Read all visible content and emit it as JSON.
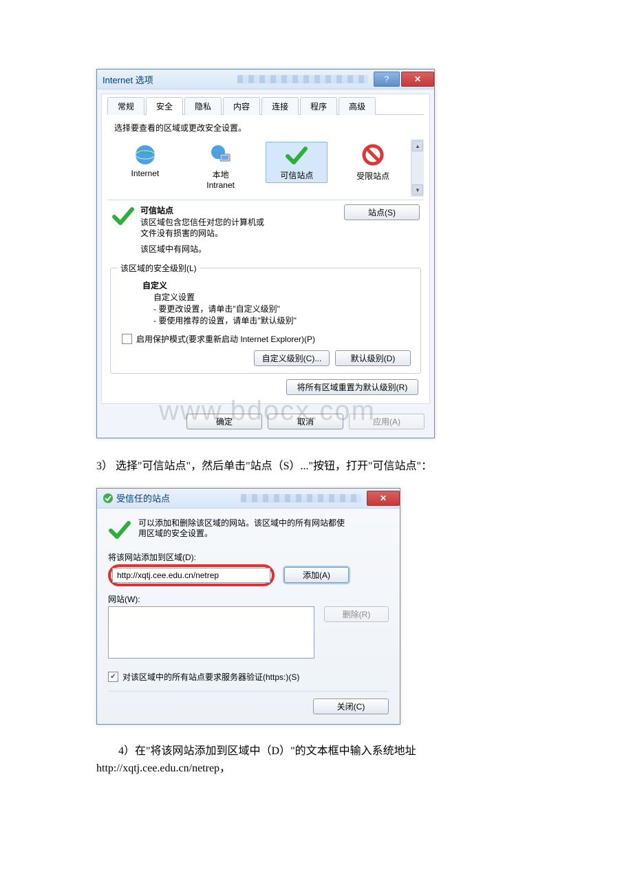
{
  "dialog1": {
    "title": "Internet 选项",
    "tabs": [
      "常规",
      "安全",
      "隐私",
      "内容",
      "连接",
      "程序",
      "高级"
    ],
    "zoneInstr": "选择要查看的区域或更改安全设置。",
    "zones": {
      "internet": {
        "label": "Internet"
      },
      "intranet": {
        "label_l1": "本地",
        "label_l2": "Intranet"
      },
      "trusted": {
        "label": "可信站点"
      },
      "restricted": {
        "label": "受限站点"
      }
    },
    "sitesBtn": "站点(S)",
    "zoneDetail": {
      "title": "可信站点",
      "line1": "该区域包含您信任对您的计算机或",
      "line2": "文件没有损害的网站。",
      "line3": "该区域中有网站。"
    },
    "secLevel": {
      "legend": "该区域的安全级别(L)",
      "custom": "自定义",
      "customSettings": "自定义设置",
      "bullet1": "- 要更改设置，请单击\"自定义级别\"",
      "bullet2": "- 要使用推荐的设置，请单击\"默认级别\"",
      "protectedMode": "启用保护模式(要求重新启动 Internet Explorer)(P)",
      "customBtn": "自定义级别(C)...",
      "defaultBtn": "默认级别(D)",
      "resetAllBtn": "将所有区域重置为默认级别(R)"
    },
    "footer": {
      "ok": "确定",
      "cancel": "取消",
      "apply": "应用(A)"
    }
  },
  "watermark": "www.bdocx.com",
  "para3": "3） 选择\"可信站点\"，然后单击\"站点（S）...\"按钮，打开\"可信站点\"：",
  "dialog2": {
    "title": "受信任的站点",
    "intro1": "可以添加和删除该区域的网站。该区域中的所有网站都使",
    "intro2": "用区域的安全设置。",
    "addLabel": "将该网站添加到区域(D):",
    "addValue": "http://xqtj.cee.edu.cn/netrep",
    "addBtn": "添加(A)",
    "sitesLabel": "网站(W):",
    "removeBtn": "删除(R)",
    "requireHttps": "对该区域中的所有站点要求服务器验证(https:)(S)",
    "closeBtn": "关闭(C)"
  },
  "para4_l1": "　　4）在\"将该网站添加到区域中（D）\"的文本框中输入系统地址",
  "para4_l2": "http://xqtj.cee.edu.cn/netrep，"
}
